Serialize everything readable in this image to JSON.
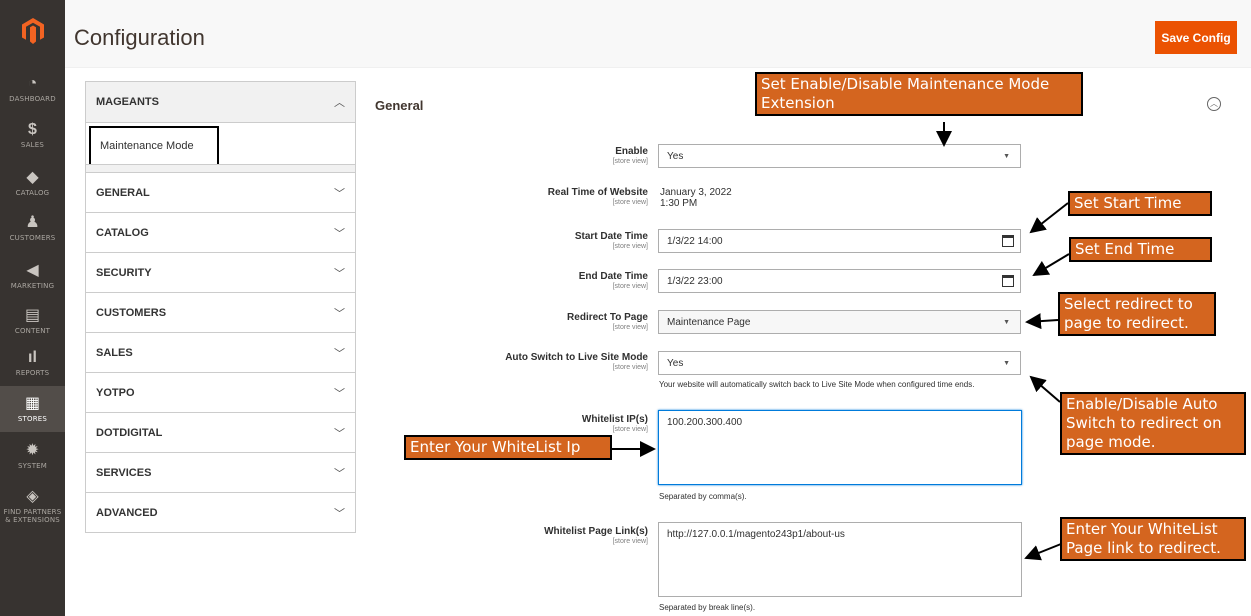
{
  "app": {
    "page_title": "Configuration",
    "save_label": "Save Config",
    "accent": "#eb5202"
  },
  "nav": {
    "items": [
      {
        "icon": "dashboard-icon",
        "glyph": "◔",
        "label": "DASHBOARD"
      },
      {
        "icon": "dollar-icon",
        "glyph": "$",
        "label": "SALES"
      },
      {
        "icon": "cube-icon",
        "glyph": "◆",
        "label": "CATALOG"
      },
      {
        "icon": "person-icon",
        "glyph": "♟",
        "label": "CUSTOMERS"
      },
      {
        "icon": "megaphone-icon",
        "glyph": "◀",
        "label": "MARKETING"
      },
      {
        "icon": "content-icon",
        "glyph": "▤",
        "label": "CONTENT"
      },
      {
        "icon": "bar-chart-icon",
        "glyph": "ıl",
        "label": "REPORTS"
      },
      {
        "icon": "store-icon",
        "glyph": "▦",
        "label": "STORES"
      },
      {
        "icon": "gear-icon",
        "glyph": "✹",
        "label": "SYSTEM"
      },
      {
        "icon": "extensions-icon",
        "glyph": "◈",
        "label": "FIND PARTNERS & EXTENSIONS"
      }
    ],
    "active": "STORES"
  },
  "tabs": {
    "group": "MAGEANTS",
    "sub_item": "Maintenance Mode",
    "sections": [
      "GENERAL",
      "CATALOG",
      "SECURITY",
      "CUSTOMERS",
      "SALES",
      "YOTPO",
      "DOTDIGITAL",
      "SERVICES",
      "ADVANCED"
    ]
  },
  "form": {
    "section_title": "General",
    "scope": "[store view]",
    "enable": {
      "label": "Enable",
      "value": "Yes"
    },
    "real_time": {
      "label": "Real Time of Website",
      "date": "January 3, 2022",
      "time": "1:30 PM"
    },
    "start": {
      "label": "Start Date Time",
      "value": "1/3/22 14:00"
    },
    "end": {
      "label": "End Date Time",
      "value": "1/3/22 23:00"
    },
    "redirect": {
      "label": "Redirect To Page",
      "value": "Maintenance Page"
    },
    "auto_switch": {
      "label": "Auto Switch to Live Site Mode",
      "value": "Yes",
      "note": "Your website will automatically switch back to Live Site Mode when configured time ends."
    },
    "whitelist_ip": {
      "label": "Whitelist IP(s)",
      "value": "100.200.300.400",
      "note": "Separated by comma(s)."
    },
    "whitelist_link": {
      "label": "Whitelist Page Link(s)",
      "value": "http://127.0.0.1/magento243p1/about-us",
      "note": "Separated by break line(s)."
    }
  },
  "callouts": {
    "enable": "Set Enable/Disable Maintenance Mode Extension",
    "start": "Set Start Time",
    "end": "Set End Time",
    "redirect": "Select redirect to page to redirect.",
    "auto": "Enable/Disable Auto Switch to redirect on page mode.",
    "ip": "Enter Your WhiteList Ip",
    "link": "Enter Your WhiteList Page link to redirect.",
    "color": "#d4651f"
  }
}
